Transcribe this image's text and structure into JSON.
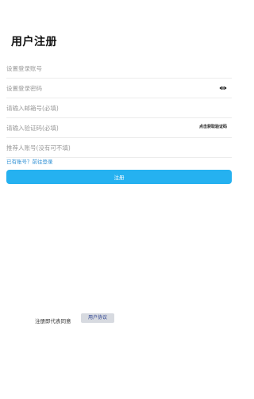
{
  "header": {
    "title": "用户注册"
  },
  "form": {
    "account_placeholder": "设置登录账号",
    "password_placeholder": "设置登录密码",
    "email_placeholder": "请输入邮箱号(必填)",
    "code_placeholder": "请输入验证码(必填)",
    "code_button_label": "点击获取验证码",
    "referrer_placeholder": "推荐人账号(没有可不填)"
  },
  "links": {
    "login_label": "已有账号？前往登录"
  },
  "actions": {
    "register_label": "注册"
  },
  "footer": {
    "agreement_text": "注册即代表同意",
    "agreement_link": "用户协议"
  },
  "colors": {
    "primary": "#25b1f0",
    "link": "#2c8fd4"
  },
  "icons": {
    "password_toggle": "eye-icon"
  }
}
